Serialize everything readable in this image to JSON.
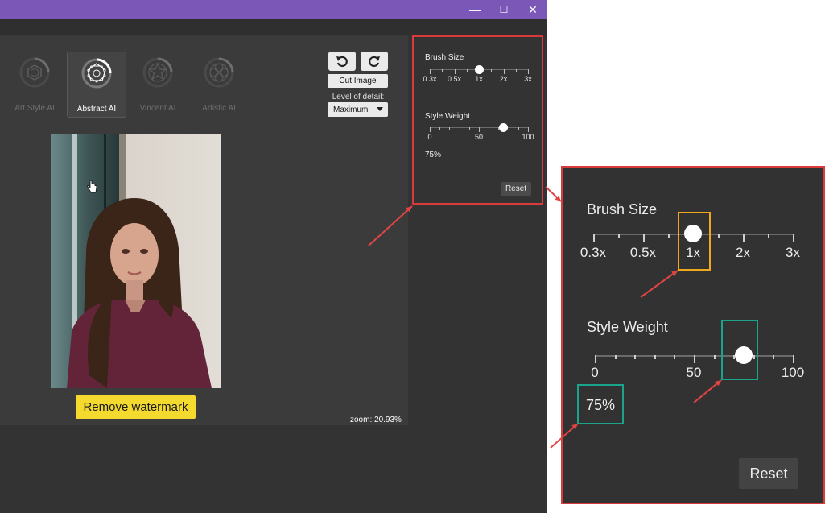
{
  "window": {
    "title_color": "#7b58b8",
    "controls": {
      "minimize": "—",
      "maximize": "☐",
      "close": "✕"
    }
  },
  "styles": [
    {
      "label": "Art Style AI",
      "icon": "hexagon-ring-icon",
      "active": false
    },
    {
      "label": "Abstract AI",
      "icon": "pentagon-ring-icon",
      "active": true
    },
    {
      "label": "Vincent AI",
      "icon": "star-ring-icon",
      "active": false
    },
    {
      "label": "Artistic AI",
      "icon": "flower-ring-icon",
      "active": false
    }
  ],
  "toolbar": {
    "undo_icon": "undo-icon",
    "redo_icon": "redo-icon",
    "cut_label": "Cut Image",
    "lod_label": "Level of detail:",
    "lod_value": "Maximum"
  },
  "canvas": {
    "action_label": "Remove watermark",
    "zoom_text": "zoom: 20.93%",
    "cursor_icon": "hand-cursor-icon",
    "action_color": "#f4d92e"
  },
  "settings": {
    "brush": {
      "title": "Brush Size",
      "ticks": [
        "0.3x",
        "0.5x",
        "1x",
        "2x",
        "3x"
      ],
      "value": "1x"
    },
    "weight": {
      "title": "Style Weight",
      "ticks": [
        "0",
        "50",
        "100"
      ],
      "value_percent": 75,
      "value_text": "75%"
    },
    "reset_label": "Reset"
  },
  "annotations": {
    "panel_border": "#d93b3b",
    "arrow_color": "#e04545",
    "brush_highlight": "#f2a81d",
    "weight_highlight": "#19a48b"
  }
}
